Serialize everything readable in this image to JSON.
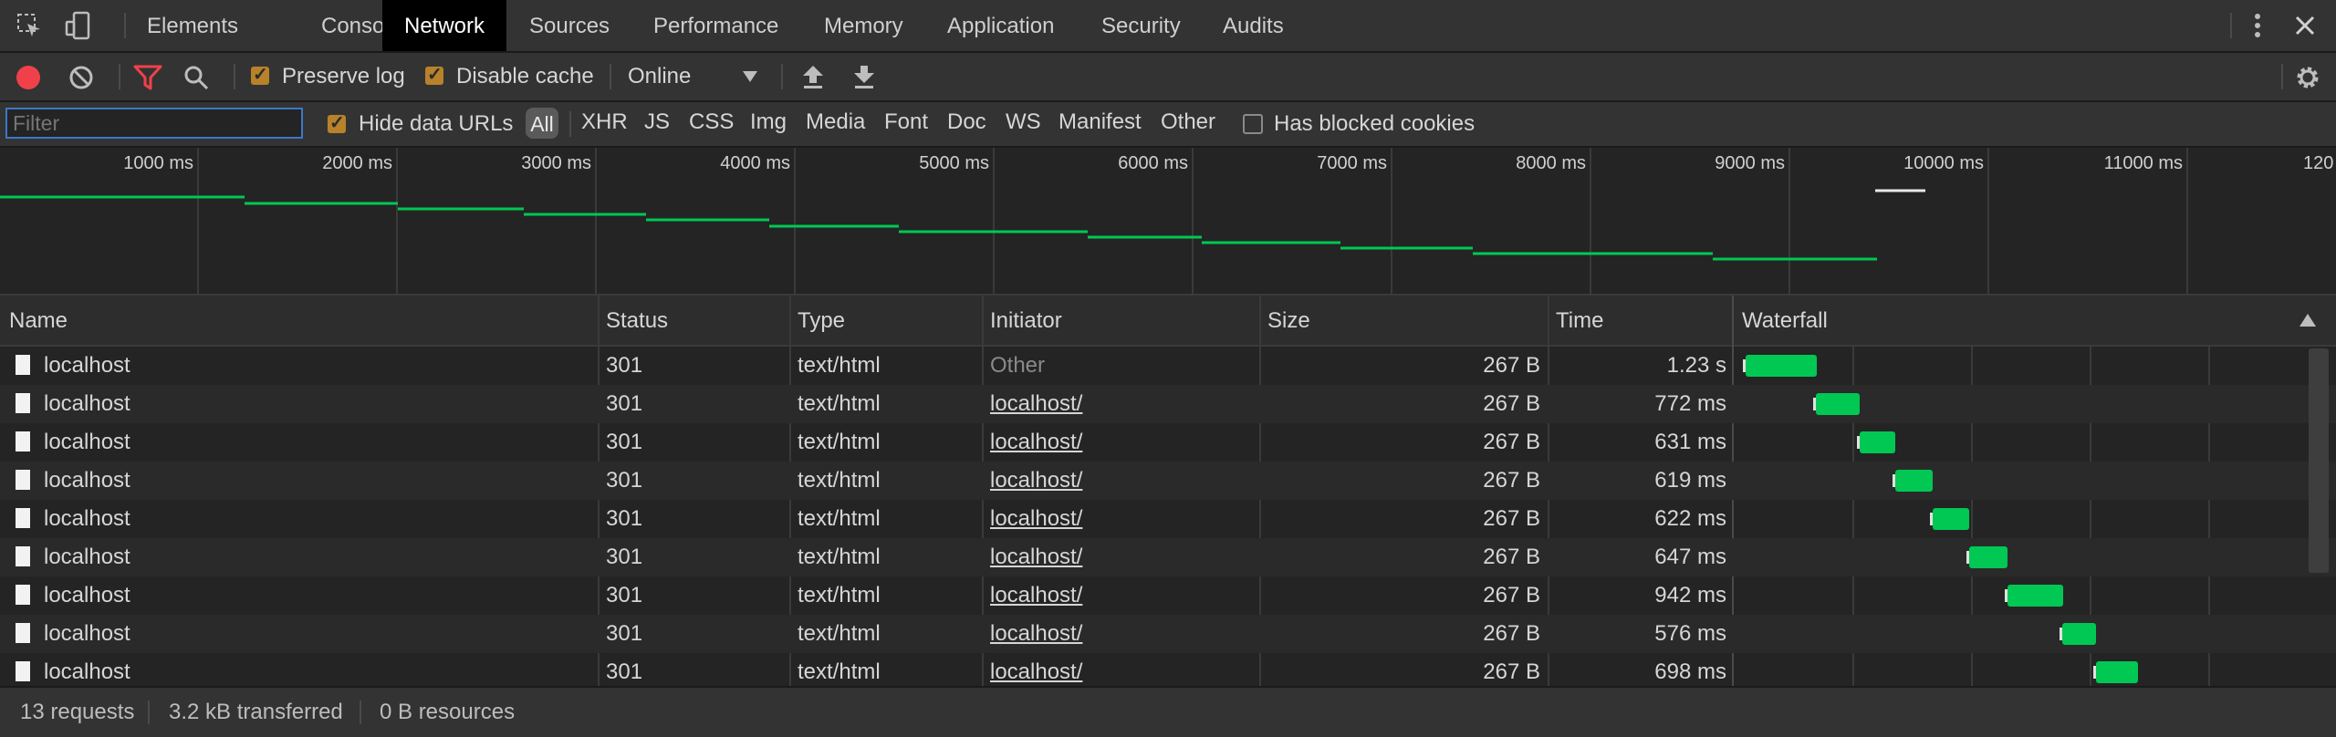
{
  "tabs": [
    "Elements",
    "Console",
    "Network",
    "Sources",
    "Performance",
    "Memory",
    "Application",
    "Security",
    "Audits"
  ],
  "active_tab": "Network",
  "toolbar": {
    "preserve_log": "Preserve log",
    "disable_cache": "Disable cache",
    "throttling": "Online"
  },
  "filterbar": {
    "filter_placeholder": "Filter",
    "hide_data_urls": "Hide data URLs",
    "types": [
      "All",
      "XHR",
      "JS",
      "CSS",
      "Img",
      "Media",
      "Font",
      "Doc",
      "WS",
      "Manifest",
      "Other"
    ],
    "has_blocked_cookies": "Has blocked cookies"
  },
  "overview": {
    "ticks": [
      "1000 ms",
      "2000 ms",
      "3000 ms",
      "4000 ms",
      "5000 ms",
      "6000 ms",
      "7000 ms",
      "8000 ms",
      "9000 ms",
      "10000 ms",
      "11000 ms",
      "120"
    ]
  },
  "table": {
    "headers": {
      "name": "Name",
      "status": "Status",
      "type": "Type",
      "initiator": "Initiator",
      "size": "Size",
      "time": "Time",
      "waterfall": "Waterfall"
    },
    "rows": [
      {
        "name": "localhost",
        "status": "301",
        "type": "text/html",
        "initiator": "Other",
        "size": "267 B",
        "time": "1.23 s"
      },
      {
        "name": "localhost",
        "status": "301",
        "type": "text/html",
        "initiator": "localhost/",
        "size": "267 B",
        "time": "772 ms"
      },
      {
        "name": "localhost",
        "status": "301",
        "type": "text/html",
        "initiator": "localhost/",
        "size": "267 B",
        "time": "631 ms"
      },
      {
        "name": "localhost",
        "status": "301",
        "type": "text/html",
        "initiator": "localhost/",
        "size": "267 B",
        "time": "619 ms"
      },
      {
        "name": "localhost",
        "status": "301",
        "type": "text/html",
        "initiator": "localhost/",
        "size": "267 B",
        "time": "622 ms"
      },
      {
        "name": "localhost",
        "status": "301",
        "type": "text/html",
        "initiator": "localhost/",
        "size": "267 B",
        "time": "647 ms"
      },
      {
        "name": "localhost",
        "status": "301",
        "type": "text/html",
        "initiator": "localhost/",
        "size": "267 B",
        "time": "942 ms"
      },
      {
        "name": "localhost",
        "status": "301",
        "type": "text/html",
        "initiator": "localhost/",
        "size": "267 B",
        "time": "576 ms"
      },
      {
        "name": "localhost",
        "status": "301",
        "type": "text/html",
        "initiator": "localhost/",
        "size": "267 B",
        "time": "698 ms"
      }
    ]
  },
  "status": {
    "requests": "13 requests",
    "transferred": "3.2 kB transferred",
    "resources": "0 B resources"
  },
  "colors": {
    "record": "#f0414b",
    "filter_active": "#f0414b",
    "waterfall_bar": "#00c853",
    "checkbox": "#b8822a"
  }
}
